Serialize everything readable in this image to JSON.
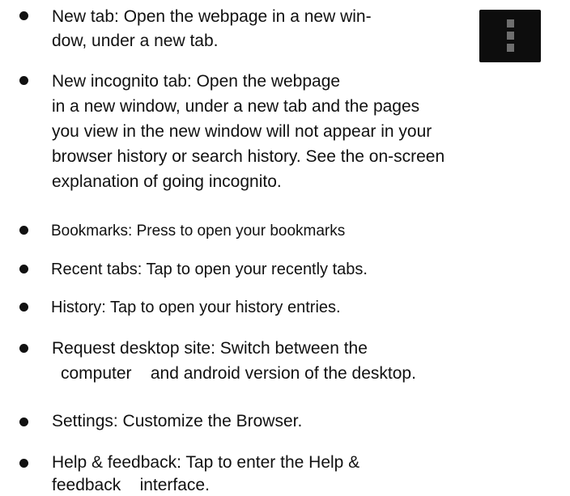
{
  "menu_icon": "overflow-menu-icon",
  "items": [
    {
      "name": "new-tab",
      "lines": [
        "New tab: Open the webpage in a new win-",
        "dow, under a new tab."
      ]
    },
    {
      "name": "new-incognito-tab",
      "lines": [
        "New incognito tab: Open the webpage",
        "in a new window, under a new tab and the pages",
        "you view in the new window will not appear in your",
        "browser history or search history. See the on-screen",
        "explanation of going incognito."
      ]
    },
    {
      "name": "bookmarks",
      "lines": [
        "Bookmarks: Press to open your bookmarks"
      ]
    },
    {
      "name": "recent-tabs",
      "lines": [
        "Recent tabs: Tap to open your recently tabs."
      ]
    },
    {
      "name": "history",
      "lines": [
        "History: Tap to open your history entries."
      ]
    },
    {
      "name": "request-desktop-site",
      "lines": [
        "Request desktop site: Switch between the",
        "computer    and android version of the desktop."
      ]
    },
    {
      "name": "settings",
      "lines": [
        "Settings: Customize the Browser."
      ]
    },
    {
      "name": "help-feedback",
      "lines": [
        "Help & feedback: Tap to enter the Help &",
        "feedback    interface."
      ]
    }
  ]
}
